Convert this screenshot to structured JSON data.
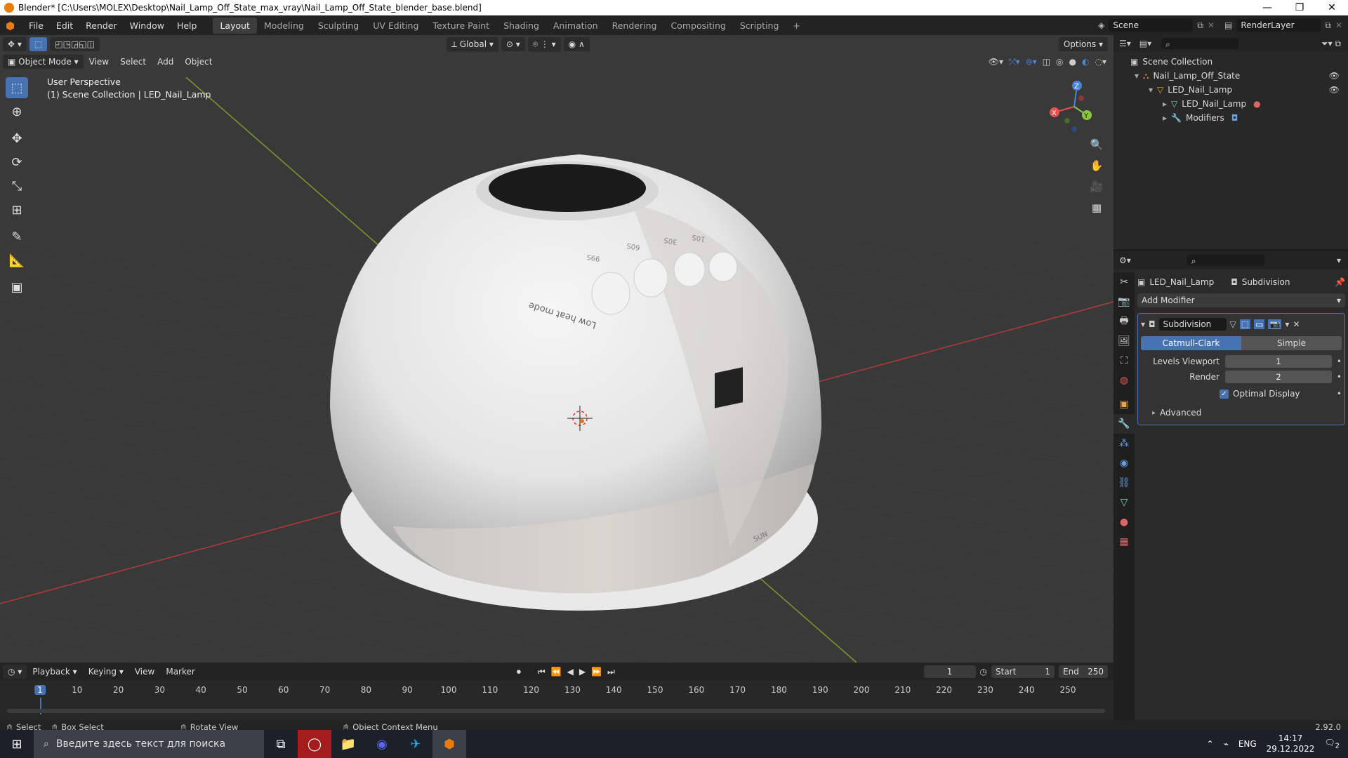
{
  "window": {
    "title": "Blender* [C:\\Users\\MOLEX\\Desktop\\Nail_Lamp_Off_State_max_vray\\Nail_Lamp_Off_State_blender_base.blend]",
    "min": "—",
    "max": "❐",
    "close": "✕"
  },
  "menu": {
    "file": "File",
    "edit": "Edit",
    "render": "Render",
    "window": "Window",
    "help": "Help"
  },
  "workspaces": [
    "Layout",
    "Modeling",
    "Sculpting",
    "UV Editing",
    "Texture Paint",
    "Shading",
    "Animation",
    "Rendering",
    "Compositing",
    "Scripting"
  ],
  "add_workspace": "+",
  "scene": {
    "name": "Scene",
    "renderlayer": "RenderLayer"
  },
  "viewport": {
    "mode": "Object Mode",
    "view": "View",
    "select": "Select",
    "add": "Add",
    "object": "Object",
    "orientation": "Global",
    "options": "Options",
    "persp": "User Perspective",
    "collection": "(1) Scene Collection | LED_Nail_Lamp",
    "gizmo": {
      "x": "X",
      "y": "Y",
      "z": "Z"
    },
    "lamp_labels": {
      "mode1": "99S",
      "mode2": "60S",
      "mode3": "30S",
      "mode4": "10S",
      "low_heat": "Low heat mode",
      "brand": "SUN"
    }
  },
  "outliner": {
    "root": "Scene Collection",
    "items": [
      {
        "label": "Nail_Lamp_Off_State",
        "icon": "collection-icon"
      },
      {
        "label": "LED_Nail_Lamp",
        "icon": "object-icon"
      },
      {
        "label": "LED_Nail_Lamp",
        "icon": "mesh-icon"
      },
      {
        "label": "Modifiers",
        "icon": "wrench-icon"
      }
    ]
  },
  "properties": {
    "object": "LED_Nail_Lamp",
    "modifier_name": "Subdivision",
    "add_modifier": "Add Modifier",
    "catmull": "Catmull-Clark",
    "simple": "Simple",
    "levels_viewport_label": "Levels Viewport",
    "levels_viewport": "1",
    "render_label": "Render",
    "render": "2",
    "optimal": "Optimal Display",
    "advanced": "Advanced"
  },
  "timeline": {
    "playback": "Playback",
    "keying": "Keying",
    "view": "View",
    "marker": "Marker",
    "current": "1",
    "start_label": "Start",
    "start": "1",
    "end_label": "End",
    "end": "250",
    "ticks": [
      "1",
      "10",
      "20",
      "30",
      "40",
      "50",
      "60",
      "70",
      "80",
      "90",
      "100",
      "110",
      "120",
      "130",
      "140",
      "150",
      "160",
      "170",
      "180",
      "190",
      "200",
      "210",
      "220",
      "230",
      "240",
      "250"
    ]
  },
  "status": {
    "select": "Select",
    "box": "Box Select",
    "rotate": "Rotate View",
    "context": "Object Context Menu",
    "version": "2.92.0"
  },
  "taskbar": {
    "search": "Введите здесь текст для поиска",
    "lang": "ENG",
    "time": "14:17",
    "date": "29.12.2022",
    "badge": "2"
  },
  "colors": {
    "accent": "#4772b3",
    "orange": "#e87d0d",
    "x_axis": "#e8504f",
    "y_axis": "#8cc63f",
    "z_axis": "#4a84d8"
  }
}
